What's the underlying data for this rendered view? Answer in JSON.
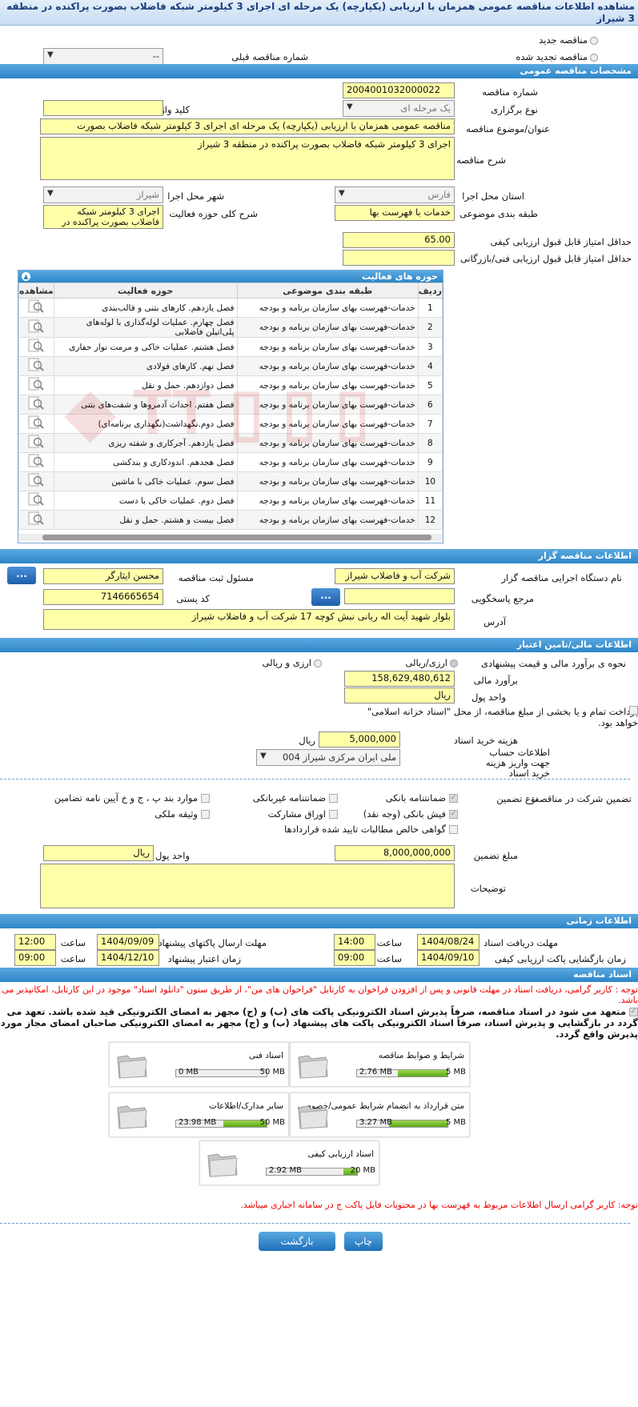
{
  "title": "مشاهده اطلاعات مناقصه عمومی همزمان با ارزیابی (یکپارچه) یک مرحله ای اجرای 3 کیلومتر شبکه فاضلاب بصورت پراکنده در منطقه 3 شیراز",
  "new_tender": "مناقصه جدید",
  "renewal_tender": "مناقصه تجدید شده",
  "prev_number_label": "شماره مناقصه قبلی",
  "prev_number_value": "--",
  "general": {
    "header": "مشخصات مناقصه عمومی",
    "number_label": "شماره مناقصه",
    "number": "2004001032000022",
    "type_label": "نوع برگزاری",
    "type": "یک مرحله ای",
    "keyword_label": "کلید واژه",
    "keyword": "",
    "subject_label": "عنوان/موضوع مناقصه",
    "subject": "مناقصه عمومی همزمان با ارزیابی (یکپارچه) یک مرحله ای اجرای 3 کیلومتر شبکه فاضلاب بصورت",
    "desc_label": "شرح مناقصه",
    "desc": "اجرای 3 کیلومتر شبکه فاضلاب بصورت پراکنده در منطقه 3 شیراز",
    "province_label": "استان محل اجرا",
    "province": "فارس",
    "city_label": "شهر محل اجرا",
    "city": "شیراز",
    "category_label": "طبقه بندی موضوعی",
    "category": "خدمات با فهرست بها",
    "activity_label": "شرح کلی حوزه فعالیت",
    "activity": "اجرای 3 کیلومتر شبکه فاضلاب بصورت پراکنده در",
    "min_quality_label": "حداقل امتیاز قابل قبول ارزیابی کیفی",
    "min_quality": "65.00",
    "min_tech_label": "حداقل امتیاز قابل قبول ارزیابی فنی/بازرگانی",
    "min_tech": ""
  },
  "activity_table": {
    "title": "حوزه های فعالیت",
    "headers": [
      "ردیف",
      "طبقه بندی موضوعی",
      "حوزه فعالیت",
      "مشاهده"
    ],
    "rows": [
      [
        "1",
        "خدمات-فهرست بهای سازمان برنامه و بودجه",
        "فصل یازدهم. کارهای بتنی و قالب‌بندی"
      ],
      [
        "2",
        "خدمات-فهرست بهای سازمان برنامه و بودجه",
        "فصل چهارم. عملیات لوله‌گذاری با لوله‌های پلی‌اتیلن فاضلابی"
      ],
      [
        "3",
        "خدمات-فهرست بهای سازمان برنامه و بودجه",
        "فصل هشتم. عملیات خاکی و مرمت نوار حفاری"
      ],
      [
        "4",
        "خدمات-فهرست بهای سازمان برنامه و بودجه",
        "فصل نهم. کارهای فولادی"
      ],
      [
        "5",
        "خدمات-فهرست بهای سازمان برنامه و بودجه",
        "فصل دوازدهم. حمل و نقل"
      ],
      [
        "6",
        "خدمات-فهرست بهای سازمان برنامه و بودجه",
        "فصل هفتم. احداث آدمروها و شفت‌های بتنی"
      ],
      [
        "7",
        "خدمات-فهرست بهای سازمان برنامه و بودجه",
        "فصل دوم.نگهداشت(نگهداری برنامه‌ای)"
      ],
      [
        "8",
        "خدمات-فهرست بهای سازمان برنامه و بودجه",
        "فصل یازدهم. آجرکاری و شفته ریزی"
      ],
      [
        "9",
        "خدمات-فهرست بهای سازمان برنامه و بودجه",
        "فصل هجدهم. اندودکاری و بندکشی"
      ],
      [
        "10",
        "خدمات-فهرست بهای سازمان برنامه و بودجه",
        "فصل سوم. عملیات خاکی با ماشین"
      ],
      [
        "11",
        "خدمات-فهرست بهای سازمان برنامه و بودجه",
        "فصل دوم. عملیات خاکی با دست"
      ],
      [
        "12",
        "خدمات-فهرست بهای سازمان برنامه و بودجه",
        "فصل بیست و هشتم. حمل و نقل"
      ]
    ]
  },
  "organizer": {
    "header": "اطلاعات مناقصه گزار",
    "org_label": "نام دستگاه اجرایی مناقصه گزار",
    "org": "شرکت آب و فاضلاب شیراز",
    "officer_label": "مسئول ثبت مناقصه",
    "officer": "محسن ایثارگر",
    "ref_label": "مرجع پاسخگویی",
    "ref": "",
    "postal_label": "کد پستی",
    "postal": "7146665654",
    "address_label": "آدرس",
    "address": "بلوار شهید آیت اله ربانی نبش کوچه 17 شرکت آب و فاضلاب شیراز",
    "btn": "..."
  },
  "finance": {
    "header": "اطلاعات مالی/تامین اعتبار",
    "method_label": "نحوه ی برآورد مالی و قیمت پیشنهادی",
    "opt1": "ارزی/ریالی",
    "opt2": "ارزی و ریالی",
    "estimate_label": "برآورد مالی",
    "estimate": "158,629,480,612",
    "currency_label": "واحد پول",
    "currency": "ریال",
    "islamic_note": "پرداخت تمام و یا بخشی از مبلغ مناقصه، از محل \"اسناد خزانه اسلامی\" خواهد بود.",
    "doc_fee_label": "هزینه خرید اسناد",
    "doc_fee": "5,000,000",
    "doc_fee_unit": "ریال",
    "account_label": "اطلاعات حساب جهت واریز هزینه خرید اسناد",
    "account": "ملی ایران مرکزی شیراز 004"
  },
  "guarantee": {
    "label": "تضمین شرکت در مناقصه:",
    "type_label": "نوع تضمین",
    "items": [
      "ضمانتنامه بانکی",
      "ضمانتنامه غیربانکی",
      "موارد بند پ ، ج و خ آیین نامه تضامین",
      "فیش بانکی (وجه نقد)",
      "اوراق مشارکت",
      "وثیقه ملکی",
      "گواهی خالص مطالبات تایید شده قراردادها"
    ],
    "amount_label": "مبلغ تضمین",
    "amount": "8,000,000,000",
    "unit_label": "واحد پول",
    "unit": "ریال",
    "notes_label": "توضیحات",
    "notes": ""
  },
  "timing": {
    "header": "اطلاعات زمانی",
    "receive_label": "مهلت دریافت اسناد",
    "receive_date": "1404/08/24",
    "receive_time": "14:00",
    "send_label": "مهلت ارسال پاکتهای پیشنهاد",
    "send_date": "1404/09/09",
    "send_time": "12:00",
    "open_label": "زمان بازگشایی پاکت ارزیابی کیفی",
    "open_date": "1404/09/10",
    "open_time": "09:00",
    "valid_label": "زمان اعتبار پیشنهاد",
    "valid_date": "1404/12/10",
    "valid_time": "09:00",
    "time_label": "ساعت"
  },
  "docs": {
    "header": "اسناد مناقصه",
    "note1": "توجه : کاربر گرامی، دریافت اسناد در مهلت قانونی و پس از افزودن فراخوان به کارتابل \"فراخوان های من\"، از طریق ستون \"دانلود اسناد\" موجود در این کارتابل، امکانپذیر می باشد.",
    "note2": "متعهد می شود در اسناد مناقصه، صرفاً پذیرش اسناد الکترونیکی پاکت های (ب) و (ج) مجهز به امضای الکترونیکی قید شده باشد. تعهد می گردد در بازگشایی و پذیرش اسناد، صرفاً اسناد الکترونیکی پاکت های پیشنهاد (ب) و (ج) مجهز به امضای الکترونیکی صاحبان امضای مجاز مورد پذیرش واقع گردد.",
    "files": [
      {
        "name": "شرایط و ضوابط مناقصه",
        "size": "2.76 MB",
        "max": "5 MB",
        "fill": 0.55
      },
      {
        "name": "اسناد فنی",
        "size": "0 MB",
        "max": "50 MB",
        "fill": 0.0
      },
      {
        "name": "متن قرارداد به انضمام شرایط عمومی/خصوصی",
        "size": "3.27 MB",
        "max": "5 MB",
        "fill": 0.65
      },
      {
        "name": "سایر مدارک/اطلاعات",
        "size": "23.98 MB",
        "max": "50 MB",
        "fill": 0.48
      },
      {
        "name": "اسناد ارزیابی کیفی",
        "size": "2.92 MB",
        "max": "20 MB",
        "fill": 0.15
      }
    ],
    "note3": "توجه: کاربر گرامی ارسال اطلاعات مربوط به فهرست بها در محتویات فایل پاکت ج در سامانه اجباری میباشد."
  },
  "buttons": {
    "print": "چاپ",
    "back": "بازگشت"
  }
}
